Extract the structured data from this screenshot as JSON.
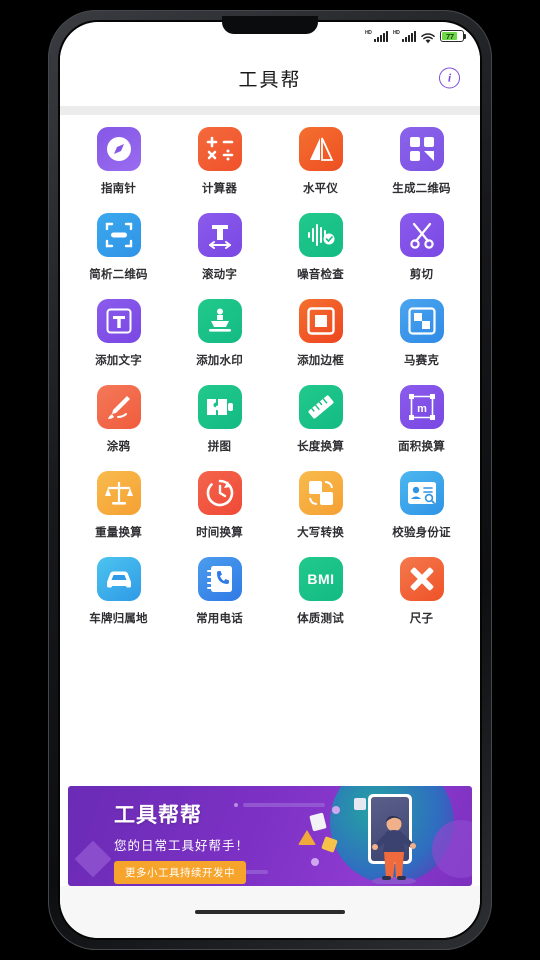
{
  "statusbar": {
    "signal_label": "HD",
    "battery_level": "77",
    "wifi_icon": "wifi-icon",
    "battery_icon": "battery-icon"
  },
  "header": {
    "title": "工具帮",
    "info_label": "i"
  },
  "tools": [
    {
      "label": "指南针",
      "icon": "compass-icon",
      "color": "#8457e6",
      "color2": "#9a6cf0"
    },
    {
      "label": "计算器",
      "icon": "calculator-icon",
      "color": "#f46a3c",
      "color2": "#f0522c"
    },
    {
      "label": "水平仪",
      "icon": "level-icon",
      "color": "#f4702f",
      "color2": "#ee4f23"
    },
    {
      "label": "生成二维码",
      "icon": "qrcode-generate-icon",
      "color": "#8a63ea",
      "color2": "#7d52e4"
    },
    {
      "label": "简析二维码",
      "icon": "qrcode-scan-icon",
      "color": "#3ba9ee",
      "color2": "#2f93e6"
    },
    {
      "label": "滚动字",
      "icon": "scrolling-text-icon",
      "color": "#8a5cec",
      "color2": "#7a47e3"
    },
    {
      "label": "噪音检查",
      "icon": "noise-meter-icon",
      "color": "#22c98c",
      "color2": "#13bb84"
    },
    {
      "label": "剪切",
      "icon": "scissors-icon",
      "color": "#8a5cec",
      "color2": "#7a47e3"
    },
    {
      "label": "添加文字",
      "icon": "add-text-icon",
      "color": "#8a5cec",
      "color2": "#7a47e3"
    },
    {
      "label": "添加水印",
      "icon": "watermark-icon",
      "color": "#22c98c",
      "color2": "#13bb84"
    },
    {
      "label": "添加边框",
      "icon": "add-border-icon",
      "color": "#f4702f",
      "color2": "#ee4520"
    },
    {
      "label": "马赛克",
      "icon": "mosaic-icon",
      "color": "#4ba5ef",
      "color2": "#2f8ae6"
    },
    {
      "label": "涂鸦",
      "icon": "graffiti-icon",
      "color": "#f4795a",
      "color2": "#ef5c3c"
    },
    {
      "label": "拼图",
      "icon": "puzzle-icon",
      "color": "#22c98c",
      "color2": "#13bb84"
    },
    {
      "label": "长度换算",
      "icon": "length-convert-icon",
      "color": "#22c98c",
      "color2": "#13bb84"
    },
    {
      "label": "面积换算",
      "icon": "area-convert-icon",
      "color": "#8a5cec",
      "color2": "#7a47e3"
    },
    {
      "label": "重量换算",
      "icon": "weight-convert-icon",
      "color": "#f9bb4d",
      "color2": "#f5a033"
    },
    {
      "label": "时间换算",
      "icon": "time-convert-icon",
      "color": "#f4644c",
      "color2": "#ef4a37"
    },
    {
      "label": "大写转换",
      "icon": "uppercase-convert-icon",
      "color": "#f9bb4d",
      "color2": "#f5a033"
    },
    {
      "label": "校验身份证",
      "icon": "id-verify-icon",
      "color": "#4cb8ef",
      "color2": "#2f93e6"
    },
    {
      "label": "车牌归属地",
      "icon": "license-plate-icon",
      "color": "#4cc4ef",
      "color2": "#2f9ae6"
    },
    {
      "label": "常用电话",
      "icon": "phone-book-icon",
      "color": "#4b9ced",
      "color2": "#2f7ae6"
    },
    {
      "label": "体质测试",
      "icon": "bmi-icon",
      "color": "#22c98c",
      "color2": "#13bb84"
    },
    {
      "label": "尺子",
      "icon": "ruler-icon",
      "color": "#f4794c",
      "color2": "#ef5228"
    }
  ],
  "banner": {
    "title": "工具帮帮",
    "subtitle": "您的日常工具好帮手！",
    "badge": "更多小工具持续开发中"
  }
}
